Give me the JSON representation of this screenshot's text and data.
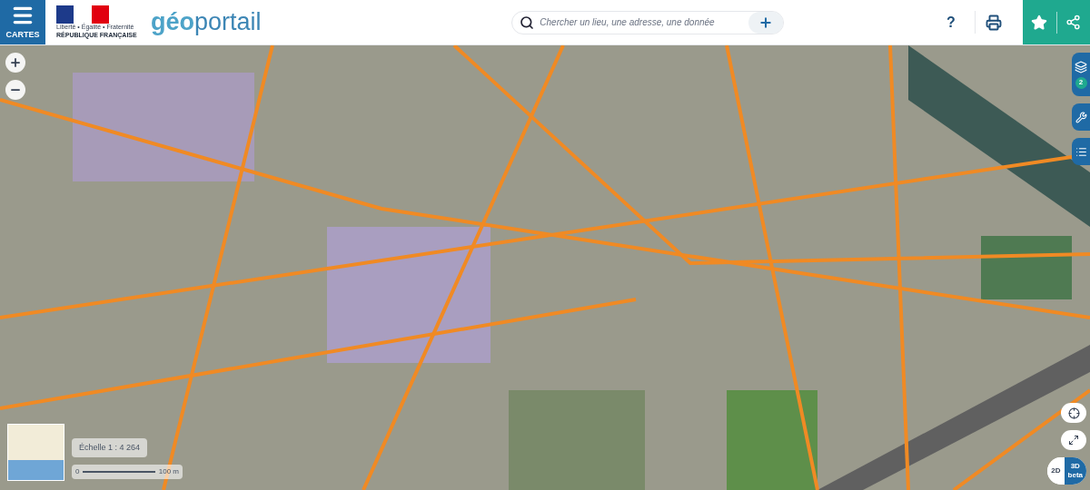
{
  "header": {
    "menu_label": "CARTES",
    "republic": {
      "motto": "Liberté • Égalité • Fraternité",
      "name": "RÉPUBLIQUE FRANÇAISE"
    },
    "logo": {
      "first": "géo",
      "second": "portail"
    },
    "search": {
      "placeholder": "Chercher un lieu, une adresse, une donnée"
    },
    "help": "?"
  },
  "map": {
    "scale": "Échelle 1 : 4 264",
    "scale_bar": {
      "start": "0",
      "end": "100 m"
    },
    "layers_count": "2",
    "view_modes": [
      {
        "label": "2D",
        "selected": false
      },
      {
        "label": "3D",
        "tag": "beta",
        "selected": true
      }
    ]
  }
}
